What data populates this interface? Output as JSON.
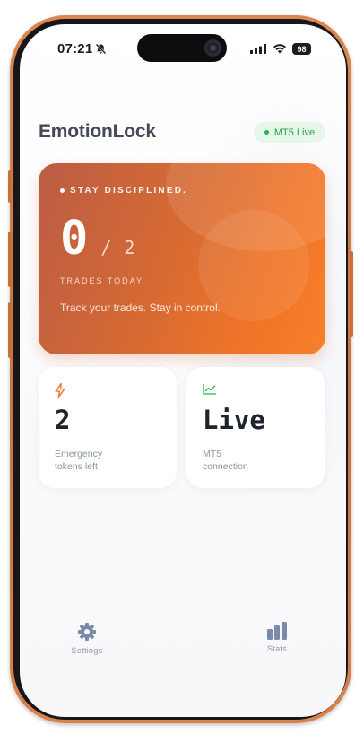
{
  "status_bar": {
    "time": "07:21",
    "battery": "98",
    "icons": [
      "bell-slash-icon",
      "signal-icon",
      "wifi-icon",
      "battery-icon"
    ]
  },
  "header": {
    "title": "EmotionLock",
    "badge": "MT5 Live",
    "badge_color": "#2cb150"
  },
  "hero": {
    "tag": "STAY DISCIPLINED.",
    "count": "0",
    "slash": "/",
    "total": "2",
    "subtitle": "TRADES TODAY",
    "note": "Track your trades. Stay in control.",
    "accent_colors": [
      "#bb5c45",
      "#f8802a"
    ]
  },
  "cards": [
    {
      "icon": "lightning-icon",
      "icon_color": "#f07a3a",
      "value": "2",
      "label_line1": "Emergency",
      "label_line2": "tokens left"
    },
    {
      "icon": "line-chart-icon",
      "icon_color": "#2cb150",
      "value": "Live",
      "label_line1": "MT5",
      "label_line2": "connection"
    }
  ],
  "nav": {
    "settings": {
      "label": "Settings",
      "icon": "gear-icon"
    },
    "stats": {
      "label": "Stats",
      "icon": "bar-chart-icon"
    },
    "icon_color": "#7a8aa8"
  }
}
